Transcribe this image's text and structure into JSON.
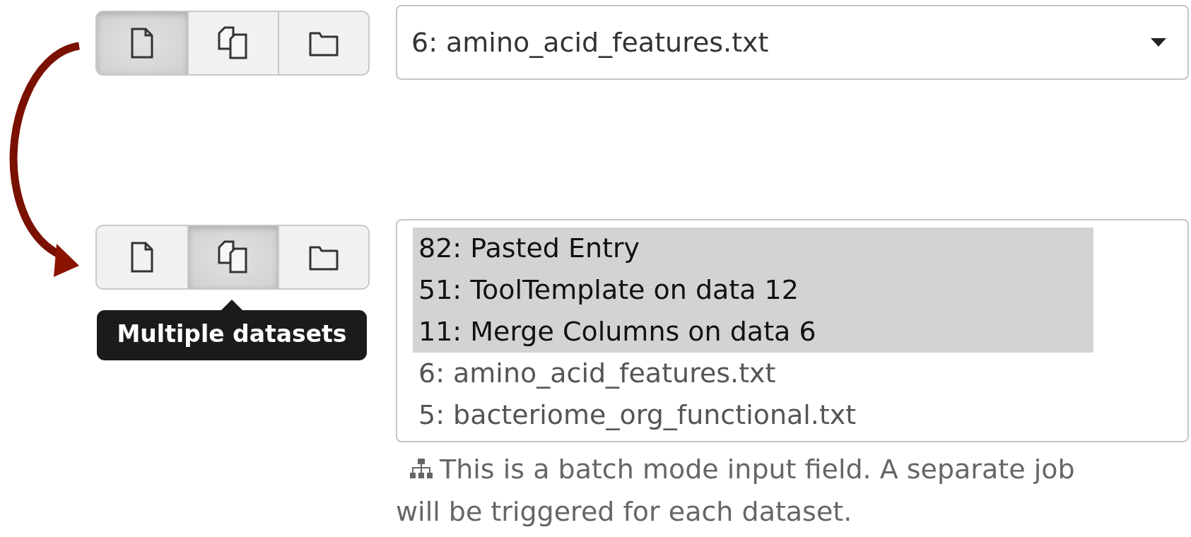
{
  "selectors": [
    {
      "kind": "dropdown",
      "modes": [
        {
          "kind": "single",
          "selected": true
        },
        {
          "kind": "multiple",
          "selected": false
        },
        {
          "kind": "collection",
          "selected": false
        }
      ],
      "value": "6: amino_acid_features.txt"
    },
    {
      "kind": "list",
      "modes": [
        {
          "kind": "single",
          "selected": false
        },
        {
          "kind": "multiple",
          "selected": true
        },
        {
          "kind": "collection",
          "selected": false
        }
      ],
      "tooltip": "Multiple datasets",
      "options": [
        {
          "label": "82: Pasted Entry",
          "selected": true
        },
        {
          "label": "51: ToolTemplate on data 12",
          "selected": true
        },
        {
          "label": "11: Merge Columns on data 6",
          "selected": true
        },
        {
          "label": "6: amino_acid_features.txt",
          "selected": false
        },
        {
          "label": "5: bacteriome_org_functional.txt",
          "selected": false
        }
      ],
      "help": "This is a batch mode input field. A separate job will be triggered for each dataset."
    }
  ]
}
